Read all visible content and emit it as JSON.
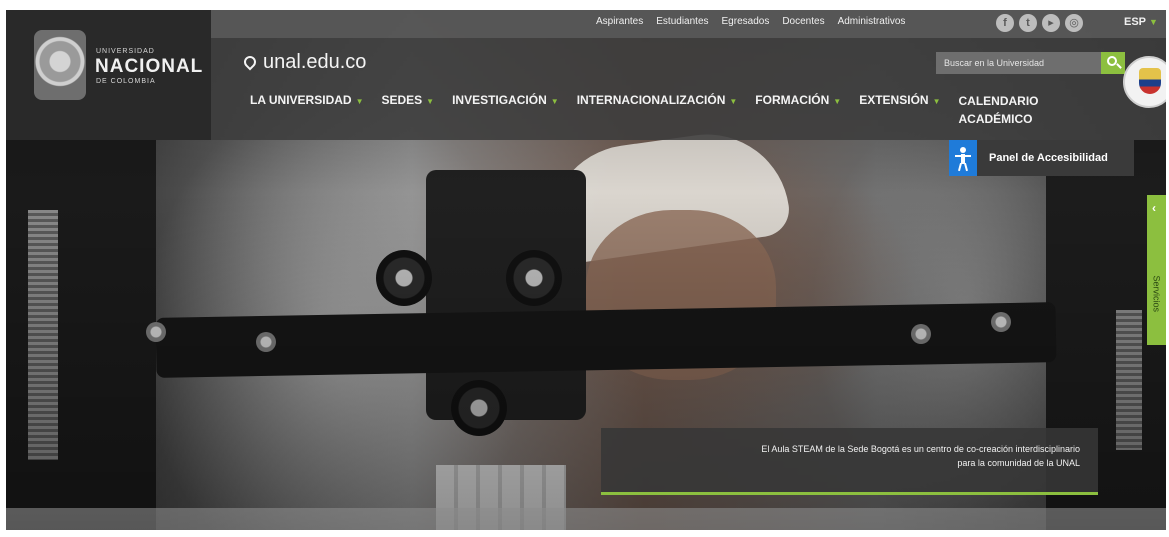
{
  "brand": {
    "small_line": "UNIVERSIDAD",
    "name": "NACIONAL",
    "sub_line": "DE COLOMBIA"
  },
  "top_links": [
    "Aspirantes",
    "Estudiantes",
    "Egresados",
    "Docentes",
    "Administrativos"
  ],
  "social_icons": [
    "facebook-icon",
    "twitter-icon",
    "youtube-icon",
    "instagram-icon"
  ],
  "language": {
    "label": "ESP"
  },
  "domain": "unal.edu.co",
  "search": {
    "placeholder": "Buscar en la Universidad"
  },
  "main_nav": {
    "items": [
      {
        "label": "LA UNIVERSIDAD"
      },
      {
        "label": "SEDES"
      },
      {
        "label": "INVESTIGACIÓN"
      },
      {
        "label": "INTERNACIONALIZACIÓN"
      },
      {
        "label": "FORMACIÓN"
      },
      {
        "label": "EXTENSIÓN"
      }
    ],
    "calendar_line1": "CALENDARIO",
    "calendar_line2": "ACADÉMICO"
  },
  "accessibility": {
    "label": "Panel de Accesibilidad"
  },
  "services_tab": {
    "label": "Servicios"
  },
  "hero": {
    "caption_line1": "El Aula STEAM de la Sede Bogotá es un centro de co-creación interdisciplinario",
    "caption_line2": "para la comunidad de la UNAL"
  },
  "colors": {
    "accent_green": "#8cbf3f",
    "header_gray": "#3c3c3c",
    "accessibility_blue": "#1f7bd9"
  }
}
